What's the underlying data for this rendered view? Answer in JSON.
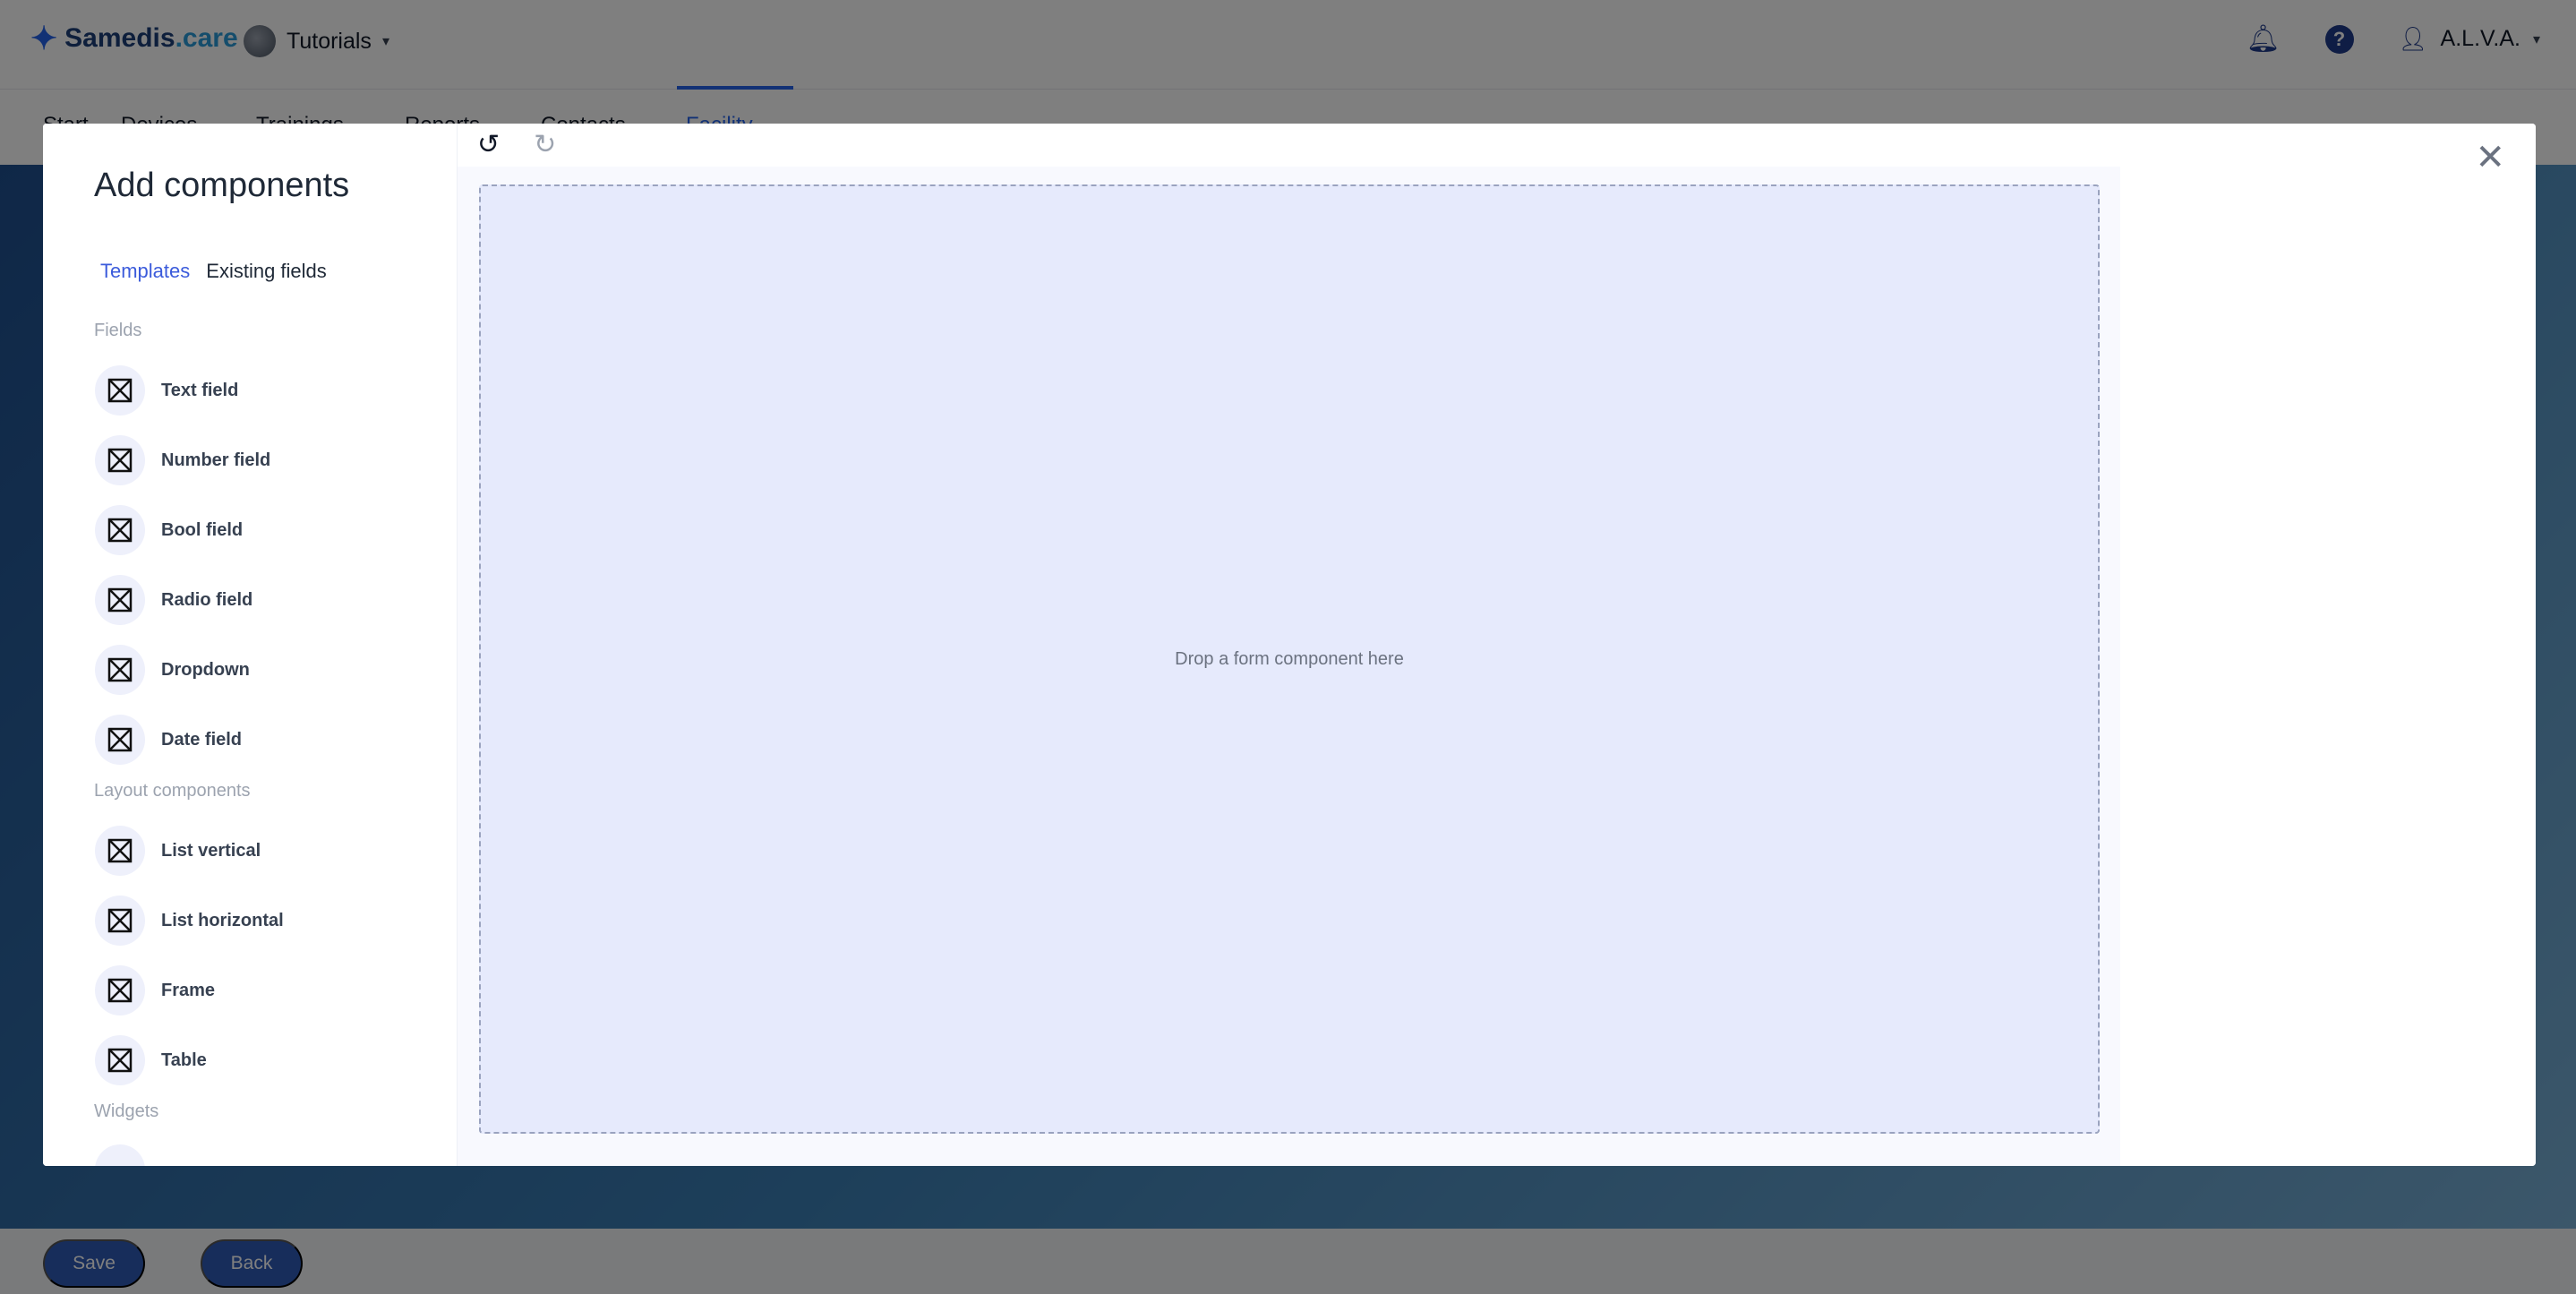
{
  "app": {
    "logo_main": "Samedis",
    "logo_dot": ".",
    "logo_suffix": "care",
    "tenant": "Tutorials",
    "user": "A.L.V.A."
  },
  "nav": {
    "tabs": [
      "Start",
      "Devices",
      "Trainings",
      "Reports",
      "Contacts",
      "Facility"
    ],
    "active_tab": "Facility"
  },
  "footer": {
    "save_label": "Save",
    "back_label": "Back"
  },
  "modal": {
    "title": "Add components",
    "tabs": [
      "Templates",
      "Existing fields"
    ],
    "active_tab": "Templates",
    "sections": {
      "fields": "Fields",
      "layout": "Layout components",
      "widgets": "Widgets"
    },
    "fields": [
      "Text field",
      "Number field",
      "Bool field",
      "Radio field",
      "Dropdown",
      "Date field"
    ],
    "layout_components": [
      "List vertical",
      "List horizontal",
      "Frame",
      "Table"
    ],
    "dropzone_text": "Drop a form component here"
  },
  "icons": {
    "undo": "undo-icon",
    "redo": "redo-icon",
    "close": "close-icon",
    "component": "box-x-icon",
    "bell": "bell-icon",
    "help": "help-icon"
  },
  "colors": {
    "primary": "#2563eb",
    "active_tab": "#3b5bdb",
    "dropzone_bg": "#e6eafc",
    "brand": "#1c3f78"
  }
}
